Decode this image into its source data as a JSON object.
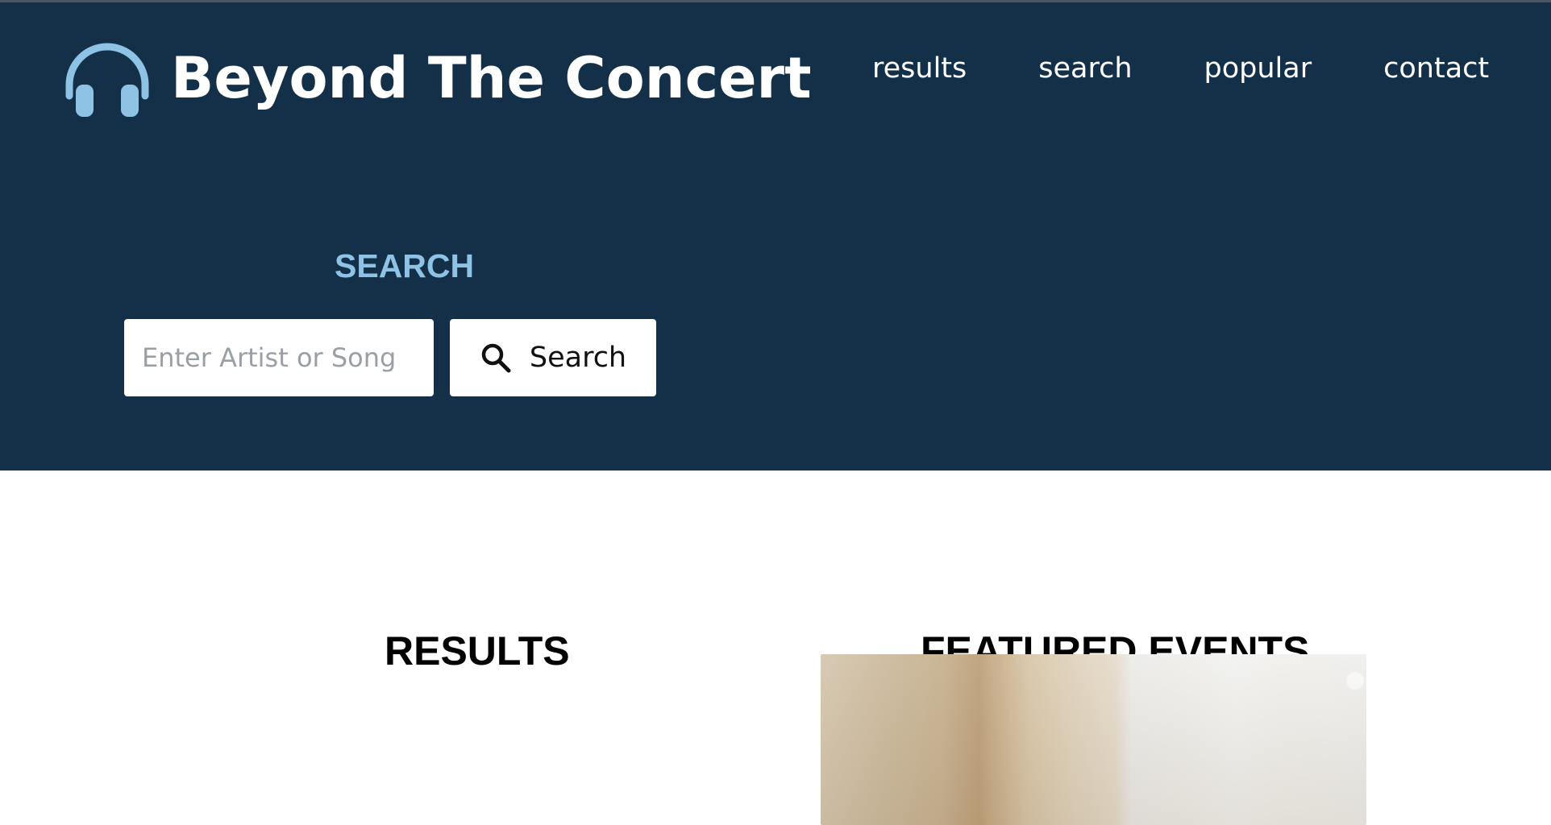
{
  "header": {
    "brand_title": "Beyond The Concert",
    "brand_icon": "headphones-icon",
    "nav": [
      {
        "label": "results"
      },
      {
        "label": "search"
      },
      {
        "label": "popular"
      },
      {
        "label": "contact"
      }
    ]
  },
  "search": {
    "heading": "SEARCH",
    "placeholder": "Enter Artist or Song",
    "value": "",
    "button_label": "Search",
    "button_icon": "search-icon"
  },
  "main": {
    "results_heading": "RESULTS",
    "featured_heading": "FEATURED EVENTS"
  },
  "colors": {
    "hero_background": "#133048",
    "accent": "#8ec3e6",
    "text_on_dark": "#ffffff",
    "page_background": "#ffffff"
  }
}
